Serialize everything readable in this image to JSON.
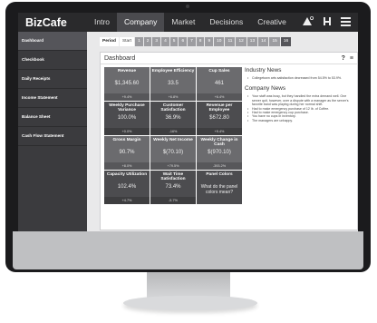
{
  "app": {
    "logo": "BizCafe"
  },
  "nav": {
    "tabs": [
      "Intro",
      "Company",
      "Market",
      "Decisions",
      "Creative"
    ]
  },
  "header_icons": [
    "chart-up-icon",
    "person-icon",
    "menu-icon"
  ],
  "sidebar": {
    "items": [
      "Dashboard",
      "Checkbook",
      "Daily Receipts",
      "Income Statement",
      "Balance Sheet",
      "Cash Flow Statement"
    ]
  },
  "period_bar": {
    "label": "Period",
    "start": "Start",
    "periods": [
      "1",
      "2",
      "3",
      "4",
      "5",
      "6",
      "7",
      "8",
      "9",
      "10",
      "11",
      "12",
      "13",
      "14",
      "15",
      "16"
    ]
  },
  "dashboard": {
    "title": "Dashboard",
    "help": "?",
    "menu": "≡",
    "tiles": [
      {
        "title": "Revenue",
        "value": "$1,345.60",
        "change": "+9.4%"
      },
      {
        "title": "Employee Efficiency",
        "value": "33.5",
        "change": "+6.8%"
      },
      {
        "title": "Cup Sales",
        "value": "461",
        "change": "+6.4%"
      },
      {
        "title": "Weekly Purchase Variance",
        "value": "100.0%",
        "change": "+0.0%"
      },
      {
        "title": "Customer Satisfaction",
        "value": "36.9%",
        "change": "-16%"
      },
      {
        "title": "Revenue per Employee",
        "value": "$672.80",
        "change": "+9.4%"
      },
      {
        "title": "Gross Margin",
        "value": "90.7%",
        "change": "+8.0%"
      },
      {
        "title": "Weekly Net Income",
        "value": "$(70.10)",
        "change": "+79.5%"
      },
      {
        "title": "Weekly Change in Cash",
        "value": "$(970.10)",
        "change": "-393.2%"
      },
      {
        "title": "Capacity Utilization",
        "value": "102.4%",
        "change": "+4.7%"
      },
      {
        "title": "Wait Time Satisfaction",
        "value": "73.4%",
        "change": "-5.7%"
      },
      {
        "title": "Panel Colors",
        "value": "What do the panel colors mean?",
        "change": ""
      }
    ]
  },
  "industry_news": {
    "title": "Industry News",
    "items": [
      "Collegetown arts satisfaction decreased from 54.5% to 53.9%."
    ]
  },
  "company_news": {
    "title": "Company News",
    "items": [
      "Your staff was busy, but they handled the extra demand well. One server quit, however, over a dispute with a manager as the server's favorite band was playing during her normal shift.",
      "Had to make emergency purchase of 12 lb. of Coffee.",
      "Had to make emergency cup purchase.",
      "You have no cups in inventory.",
      "The managers are unhappy."
    ]
  }
}
